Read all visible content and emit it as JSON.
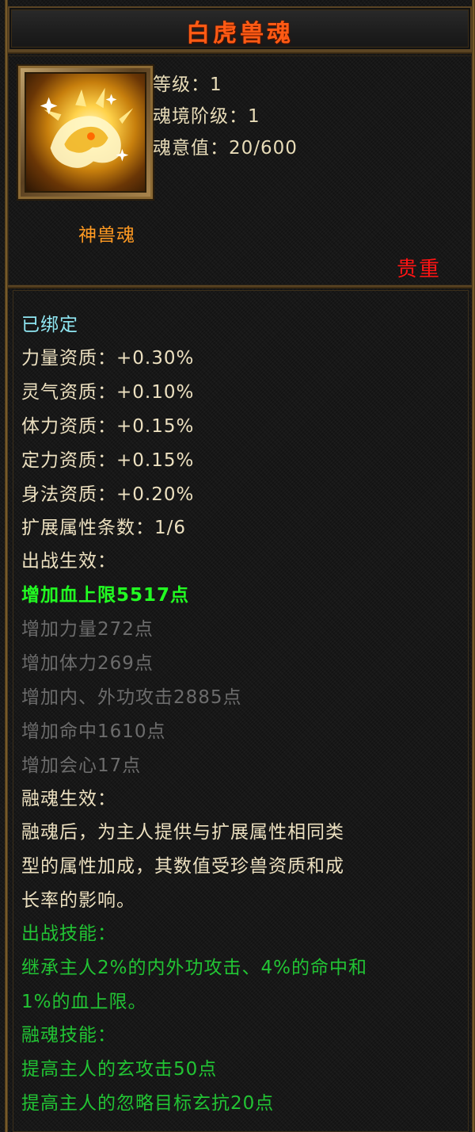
{
  "title": "白虎兽魂",
  "header": {
    "icon": "white-tiger-soul-icon",
    "level_line": "等级：1",
    "realm_line": "魂境阶级：1",
    "soul_value_line": "魂意值：20/600",
    "item_type": "神兽魂",
    "rarity": "贵重"
  },
  "details": {
    "bound": "已绑定",
    "aptitudes": [
      "力量资质：+0.30%",
      "灵气资质：+0.10%",
      "体力资质：+0.15%",
      "定力资质：+0.15%",
      "身法资质：+0.20%"
    ],
    "ext_count": "扩展属性条数：1/6",
    "battle_effect_heading": "出战生效：",
    "active_bonus": "增加血上限5517点",
    "inactive_bonuses": [
      "增加力量272点",
      "增加体力269点",
      "增加内、外功攻击2885点",
      "增加命中1610点",
      "增加会心17点"
    ],
    "merge_effect_heading": "融魂生效：",
    "merge_effect_desc": [
      "融魂后，为主人提供与扩展属性相同类",
      "型的属性加成，其数值受珍兽资质和成",
      "长率的影响。"
    ],
    "battle_skill_heading": "出战技能：",
    "battle_skill_desc": [
      "继承主人2%的内外功攻击、4%的命中和",
      "1%的血上限。"
    ],
    "merge_skill_heading": "融魂技能：",
    "merge_skills": [
      "提高主人的玄攻击50点",
      "提高主人的忽略目标玄抗20点"
    ]
  },
  "colors": {
    "title": "#ff5a14",
    "item_type": "#ff9a22",
    "rarity": "#ff1414",
    "bound": "#8fe6f2",
    "active_bonus": "#22ff22",
    "inactive": "#6c6c6c",
    "skill": "#22c434"
  }
}
